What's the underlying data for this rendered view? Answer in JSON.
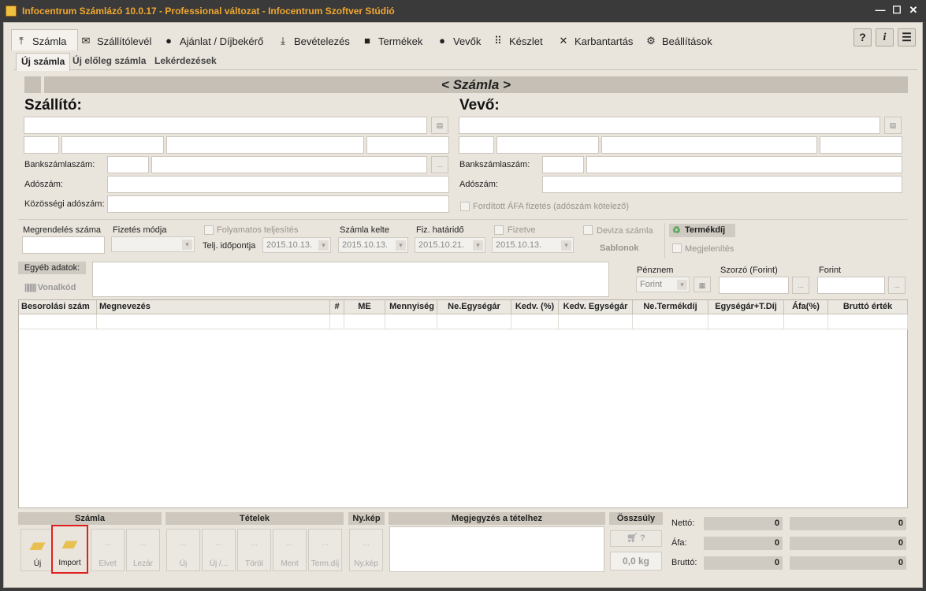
{
  "window": {
    "title": "Infocentrum Számlázó 10.0.17 - Professional változat - Infocentrum Szoftver Stúdió",
    "minimize": "—",
    "maximize": "☐",
    "close": "✕"
  },
  "menu": [
    {
      "label": "Számla",
      "icon": "upload-icon"
    },
    {
      "label": "Szállítólevél",
      "icon": "envelope-icon"
    },
    {
      "label": "Ajánlat / Díjbekérő",
      "icon": "handshake-icon"
    },
    {
      "label": "Bevételezés",
      "icon": "download-icon"
    },
    {
      "label": "Termékek",
      "icon": "box-icon"
    },
    {
      "label": "Vevők",
      "icon": "user-icon"
    },
    {
      "label": "Készlet",
      "icon": "grid-icon"
    },
    {
      "label": "Karbantartás",
      "icon": "tools-icon"
    },
    {
      "label": "Beállítások",
      "icon": "gear-icon"
    }
  ],
  "toolbar_right": {
    "help": "?",
    "info": "i",
    "list": "☰"
  },
  "subtabs": [
    "Új számla",
    "Új előleg számla",
    "Lekérdezések"
  ],
  "banner": "< Számla >",
  "supplier": {
    "title": "Szállító:",
    "bank_label": "Bankszámlaszám:",
    "tax_label": "Adószám:",
    "eu_tax_label": "Közösségi adószám:"
  },
  "buyer": {
    "title": "Vevő:",
    "bank_label": "Bankszámlaszám:",
    "tax_label": "Adószám:",
    "reverse_vat_label": "Fordított ÁFA fizetés (adószám kötelező)"
  },
  "order": {
    "order_no_label": "Megrendelés száma",
    "payment_label": "Fizetés módja",
    "continuous_label": "Folyamatos teljesítés",
    "perf_date_label": "Telj. időpontja",
    "perf_date": "2015.10.13.",
    "invoice_date_label": "Számla kelte",
    "invoice_date": "2015.10.13.",
    "due_label": "Fiz. határidő",
    "due_date": "2015.10.21.",
    "paid_label": "Fizetve",
    "paid_date": "2015.10.13.",
    "foreign_label": "Deviza számla",
    "templates": "Sablonok",
    "product_fee": "Termékdíj",
    "show_label": "Megjelenítés"
  },
  "other": {
    "label": "Egyéb adatok:",
    "barcode": "Vonalkód",
    "currency_label": "Pénznem",
    "currency": "Forint",
    "multiplier_label": "Szorzó (Forint)",
    "forint_label": "Forint",
    "dots": "..."
  },
  "grid": {
    "columns": [
      "Besorolási szám",
      "Megnevezés",
      "#",
      "ME",
      "Mennyiség",
      "Ne.Egységár",
      "Kedv. (%)",
      "Kedv. Egységár",
      "Ne.Termékdíj",
      "Egységár+T.Díj",
      "Áfa(%)",
      "Bruttó érték"
    ]
  },
  "bottom": {
    "sections": [
      "Számla",
      "Tételek",
      "Ny.kép",
      "Megjegyzés a tételhez",
      "Összsúly"
    ],
    "invoice_buttons": [
      "Új",
      "Import",
      "Elvet",
      "Lezár"
    ],
    "item_buttons": [
      "Új",
      "Új /...",
      "Töröl",
      "Ment",
      "Term.díj"
    ],
    "print_button": "Ny.kép",
    "weight_button": "?",
    "weight": "0,0 kg",
    "totals": [
      {
        "label": "Nettó:",
        "a": "0",
        "b": "0"
      },
      {
        "label": "Áfa:",
        "a": "0",
        "b": "0"
      },
      {
        "label": "Bruttó:",
        "a": "0",
        "b": "0"
      }
    ]
  },
  "colors": {
    "accent_title": "#f0a830",
    "highlight_box": "#e02020"
  }
}
